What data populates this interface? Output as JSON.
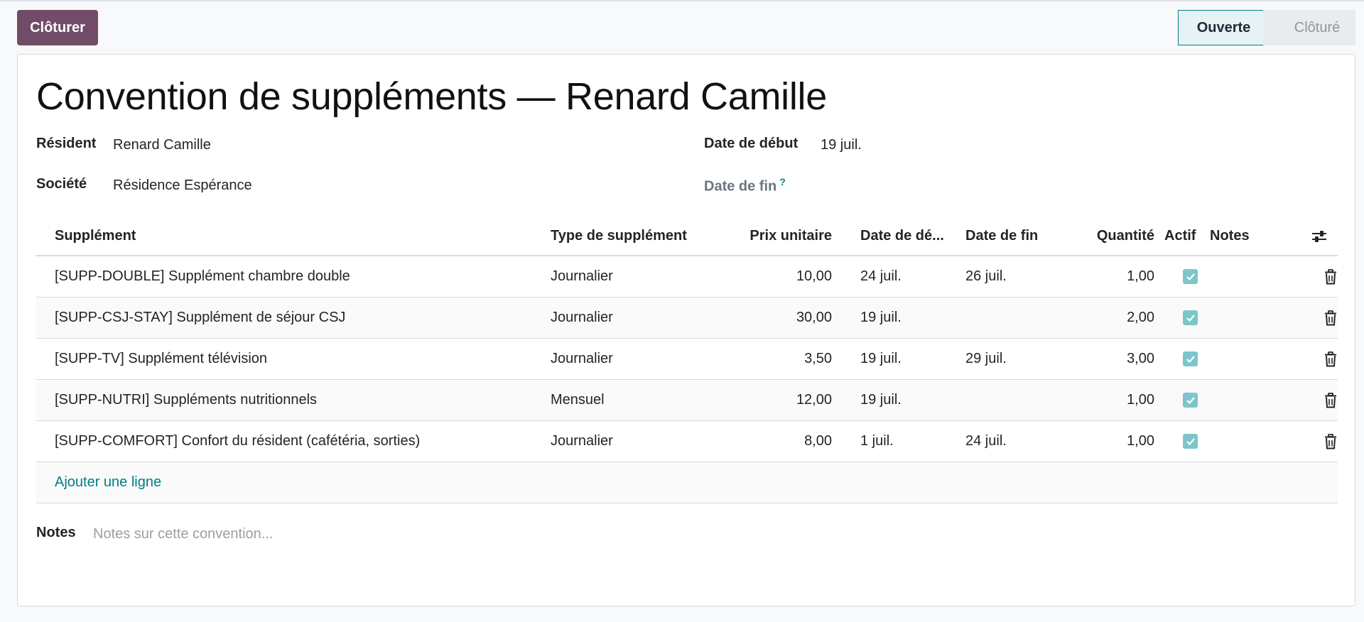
{
  "actions": {
    "close_label": "Clôturer"
  },
  "statusbar": {
    "stages": [
      "Ouverte",
      "Clôturé"
    ],
    "active": "Ouverte"
  },
  "record": {
    "title": "Convention de suppléments — Renard Camille",
    "fields": {
      "resident_label": "Résident",
      "resident_value": "Renard Camille",
      "company_label": "Société",
      "company_value": "Résidence Espérance",
      "start_label": "Date de début",
      "start_value": "19 juil.",
      "end_label": "Date de fin",
      "end_help": "?"
    }
  },
  "table": {
    "columns": [
      "Supplément",
      "Type de supplément",
      "Prix unitaire",
      "Date de dé...",
      "Date de fin",
      "Quantité",
      "Actif",
      "Notes"
    ],
    "rows": [
      {
        "product": "[SUPP-DOUBLE] Supplément chambre double",
        "type": "Journalier",
        "price": "10,00",
        "start": "24 juil.",
        "end": "26 juil.",
        "qty": "1,00",
        "active": true
      },
      {
        "product": "[SUPP-CSJ-STAY] Supplément de séjour CSJ",
        "type": "Journalier",
        "price": "30,00",
        "start": "19 juil.",
        "end": "",
        "qty": "2,00",
        "active": true
      },
      {
        "product": "[SUPP-TV] Supplément télévision",
        "type": "Journalier",
        "price": "3,50",
        "start": "19 juil.",
        "end": "29 juil.",
        "qty": "3,00",
        "active": true
      },
      {
        "product": "[SUPP-NUTRI] Suppléments nutritionnels",
        "type": "Mensuel",
        "price": "12,00",
        "start": "19 juil.",
        "end": "",
        "qty": "1,00",
        "active": true
      },
      {
        "product": "[SUPP-COMFORT] Confort du résident (cafétéria, sorties)",
        "type": "Journalier",
        "price": "8,00",
        "start": "1 juil.",
        "end": "24 juil.",
        "qty": "1,00",
        "active": true
      }
    ],
    "add_line_label": "Ajouter une ligne",
    "accent_color": "#017e84"
  },
  "notes": {
    "label": "Notes",
    "placeholder": "Notes sur cette convention..."
  },
  "icons": {
    "optional_columns": "sliders-icon",
    "delete": "trash-icon",
    "checkbox": "checkmark-icon"
  },
  "colors": {
    "primary": "#714b67",
    "accent": "#017e84",
    "checkbox": "#7cc6cb"
  }
}
